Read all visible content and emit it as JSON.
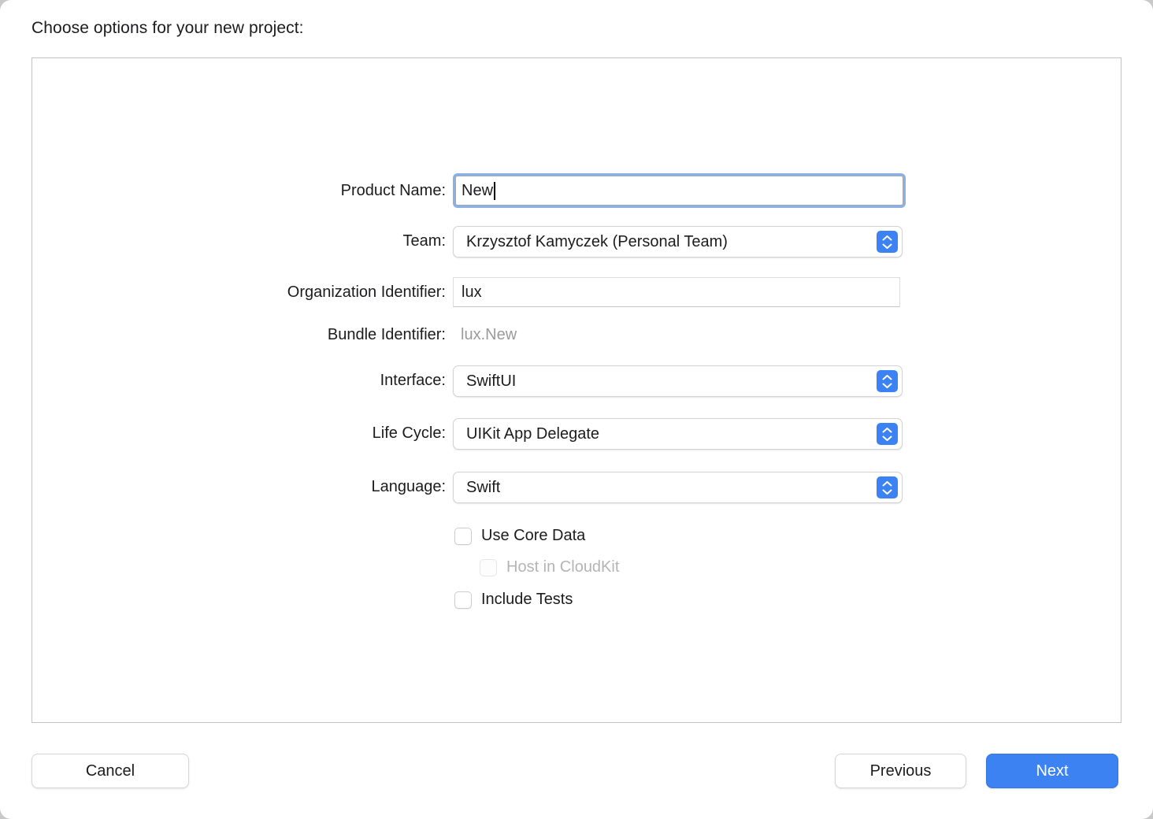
{
  "dialog": {
    "title": "Choose options for your new project:"
  },
  "form": {
    "rows": [
      {
        "label": "Product Name:",
        "value": "New",
        "type": "textfield-focused"
      },
      {
        "label": "Team:",
        "value": "Krzysztof Kamyczek (Personal Team)",
        "type": "popup"
      },
      {
        "label": "Organization Identifier:",
        "value": "lux",
        "type": "textfield"
      },
      {
        "label": "Bundle Identifier:",
        "value": "lux.New",
        "type": "static"
      },
      {
        "label": "Interface:",
        "value": "SwiftUI",
        "type": "popup"
      },
      {
        "label": "Life Cycle:",
        "value": "UIKit App Delegate",
        "type": "popup"
      },
      {
        "label": "Language:",
        "value": "Swift",
        "type": "popup"
      }
    ],
    "checkboxes": [
      {
        "label": "Use Core Data",
        "checked": false,
        "disabled": false
      },
      {
        "label": "Host in CloudKit",
        "checked": false,
        "disabled": true
      },
      {
        "label": "Include Tests",
        "checked": false,
        "disabled": false
      }
    ]
  },
  "footer": {
    "cancel_label": "Cancel",
    "previous_label": "Previous",
    "next_label": "Next"
  },
  "colors": {
    "accent_blue": "#3c82f3",
    "focus_ring": "#8ab0e8",
    "disabled_text": "#b4b4b4",
    "static_text": "#9b9b9b"
  }
}
